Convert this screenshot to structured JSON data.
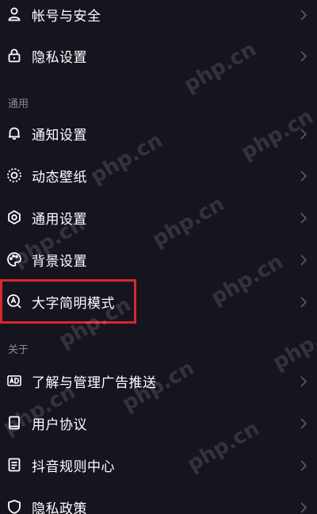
{
  "account": {
    "items": [
      {
        "icon": "user-icon",
        "label": "帐号与安全"
      },
      {
        "icon": "lock-icon",
        "label": "隐私设置"
      }
    ]
  },
  "general": {
    "title": "通用",
    "items": [
      {
        "icon": "bell-icon",
        "label": "通知设置"
      },
      {
        "icon": "sparkle-circle-icon",
        "label": "动态壁纸"
      },
      {
        "icon": "gear-icon",
        "label": "通用设置"
      },
      {
        "icon": "palette-icon",
        "label": "背景设置"
      },
      {
        "icon": "search-a-icon",
        "label": "大字简明模式"
      }
    ]
  },
  "about": {
    "title": "关于",
    "items": [
      {
        "icon": "ad-icon",
        "label": "了解与管理广告推送"
      },
      {
        "icon": "book-icon",
        "label": "用户协议"
      },
      {
        "icon": "rules-icon",
        "label": "抖音规则中心"
      },
      {
        "icon": "shield-icon",
        "label": "隐私政策"
      }
    ]
  },
  "watermark": {
    "text": "php.cn"
  },
  "colors": {
    "background": "#16151f",
    "text": "#ffffff",
    "section_title": "#8a8994",
    "highlight": "#d8262e",
    "chevron": "#5d5c66"
  }
}
